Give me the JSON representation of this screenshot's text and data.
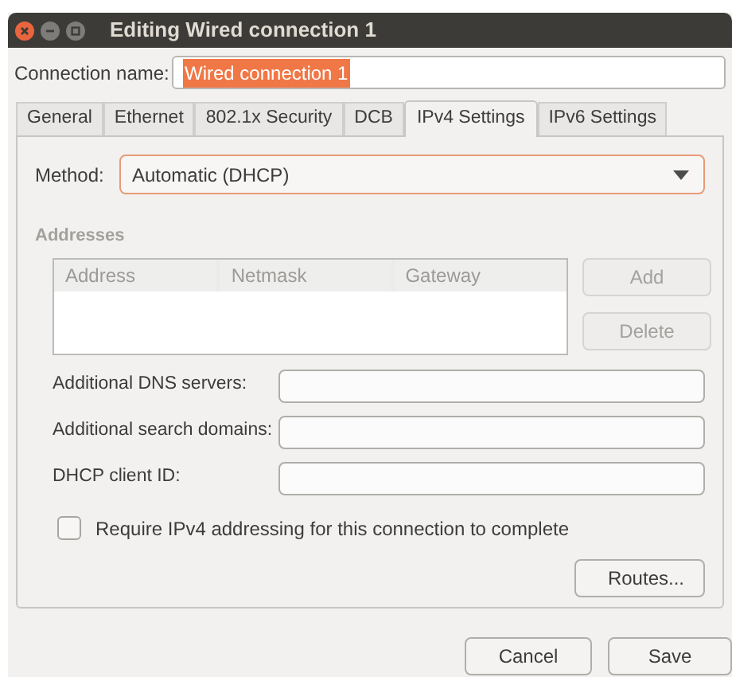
{
  "window": {
    "title": "Editing Wired connection 1"
  },
  "connection_name": {
    "label": "Connection name:",
    "value": "Wired connection 1",
    "selected": true
  },
  "tabs": [
    {
      "label": "General",
      "selected": false
    },
    {
      "label": "Ethernet",
      "selected": false
    },
    {
      "label": "802.1x Security",
      "selected": false
    },
    {
      "label": "DCB",
      "selected": false
    },
    {
      "label": "IPv4 Settings",
      "selected": true
    },
    {
      "label": "IPv6 Settings",
      "selected": false
    }
  ],
  "method": {
    "label": "Method:",
    "value": "Automatic (DHCP)",
    "focused": true
  },
  "addresses": {
    "heading": "Addresses",
    "disabled": true,
    "columns": [
      "Address",
      "Netmask",
      "Gateway"
    ],
    "buttons": [
      {
        "label": "Add",
        "disabled": true
      },
      {
        "label": "Delete",
        "disabled": true
      }
    ]
  },
  "fields": [
    {
      "label": "Additional DNS servers:"
    },
    {
      "label": "Additional search domains:"
    },
    {
      "label": "DHCP client ID:"
    }
  ],
  "require_ipv4": {
    "label": "Require IPv4 addressing for this connection to complete",
    "checked": false
  },
  "routes_button": {
    "label": "Routes..."
  },
  "buttons": [
    {
      "label": "Cancel"
    },
    {
      "label": "Save"
    }
  ]
}
